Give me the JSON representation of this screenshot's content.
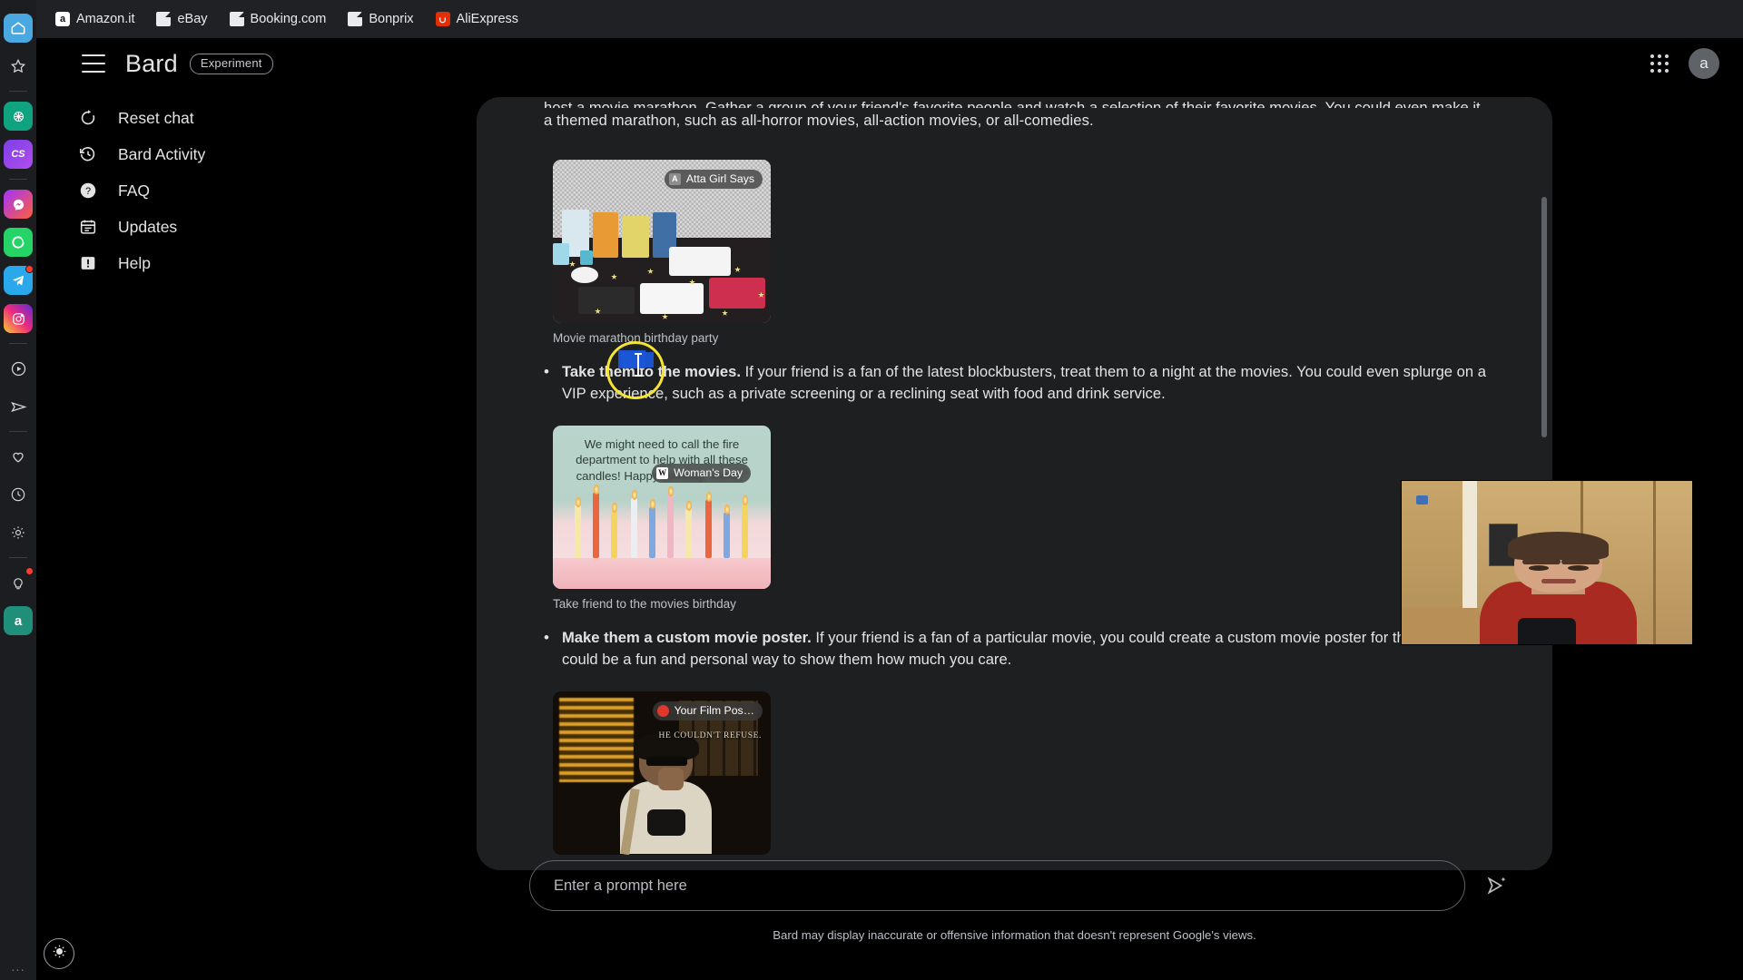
{
  "browser": {
    "bookmarks": [
      {
        "label": "Amazon.it",
        "icon": "amazon-favicon",
        "color": "#ffffff",
        "glyph": "a"
      },
      {
        "label": "eBay",
        "icon": "generic-page-favicon",
        "color": "#e8eaed",
        "glyph": ""
      },
      {
        "label": "Booking.com",
        "icon": "generic-page-favicon",
        "color": "#e8eaed",
        "glyph": ""
      },
      {
        "label": "Bonprix",
        "icon": "generic-page-favicon",
        "color": "#e8eaed",
        "glyph": ""
      },
      {
        "label": "AliExpress",
        "icon": "aliexpress-favicon",
        "color": "#e62e04",
        "glyph": ""
      }
    ]
  },
  "rail": {
    "items": [
      {
        "name": "home-icon",
        "glyph": "home",
        "active": true,
        "badge": false
      },
      {
        "name": "star-icon",
        "glyph": "star",
        "active": false,
        "badge": false
      },
      {
        "name": "separator",
        "glyph": "sep",
        "active": false,
        "badge": false
      },
      {
        "name": "openai-icon",
        "glyph": "openai",
        "active": false,
        "badge": false
      },
      {
        "name": "cs-icon",
        "glyph": "cs",
        "active": false,
        "badge": false
      },
      {
        "name": "separator",
        "glyph": "sep",
        "active": false,
        "badge": false
      },
      {
        "name": "messenger-icon",
        "glyph": "messenger",
        "active": false,
        "badge": false
      },
      {
        "name": "whatsapp-icon",
        "glyph": "whatsapp",
        "active": false,
        "badge": false
      },
      {
        "name": "telegram-icon",
        "glyph": "telegram",
        "active": false,
        "badge": true
      },
      {
        "name": "instagram-icon",
        "glyph": "instagram",
        "active": false,
        "badge": false
      },
      {
        "name": "separator",
        "glyph": "sep",
        "active": false,
        "badge": false
      },
      {
        "name": "play-circle-icon",
        "glyph": "play",
        "active": false,
        "badge": false
      },
      {
        "name": "send-icon",
        "glyph": "send",
        "active": false,
        "badge": false
      },
      {
        "name": "separator",
        "glyph": "sep",
        "active": false,
        "badge": false
      },
      {
        "name": "heart-icon",
        "glyph": "heart",
        "active": false,
        "badge": false
      },
      {
        "name": "clock-icon",
        "glyph": "clock",
        "active": false,
        "badge": false
      },
      {
        "name": "gear-icon",
        "glyph": "gear",
        "active": false,
        "badge": false
      },
      {
        "name": "separator",
        "glyph": "sep",
        "active": false,
        "badge": false
      },
      {
        "name": "lightbulb-icon",
        "glyph": "bulb",
        "active": false,
        "badge": true
      },
      {
        "name": "amazon-assistant-icon",
        "glyph": "a",
        "active": false,
        "badge": false
      }
    ],
    "overflow_label": "..."
  },
  "header": {
    "title": "Bard",
    "chip": "Experiment",
    "avatar_initial": "a"
  },
  "nav": {
    "items": [
      {
        "label": "Reset chat",
        "icon": "reset-icon"
      },
      {
        "label": "Bard Activity",
        "icon": "history-icon"
      },
      {
        "label": "FAQ",
        "icon": "question-mark-icon"
      },
      {
        "label": "Updates",
        "icon": "calendar-icon"
      },
      {
        "label": "Help",
        "icon": "help-feedback-icon"
      }
    ]
  },
  "conversation": {
    "clipped_top_line": "host a movie marathon. Gather a group of your friend's favorite people and watch a selection of their favorite movies. You could even make it",
    "intro_line": "a themed marathon, such as all-horror movies, all-action movies, or all-comedies.",
    "blocks": [
      {
        "image_name": "movie-marathon-party-image",
        "badge_label": "Atta Girl Says",
        "badge_icon": "atta-girl-says-favicon",
        "badge_color": "#8d8d8d",
        "badge_glyph": "A",
        "caption": "Movie marathon birthday party"
      },
      {
        "bullet_bold": "Take them to the movies.",
        "bullet_text": " If your friend is a fan of the latest blockbusters, treat them to a night at the movies. You could even splurge on a VIP experience, such as a private screening or a reclining seat with food and drink service."
      },
      {
        "image_name": "birthday-candles-image",
        "badge_label": "Woman's Day",
        "badge_icon": "womans-day-favicon",
        "badge_color": "#ffffff",
        "badge_glyph": "W",
        "caption": "Take friend to the movies birthday",
        "overlay_quote": "We might need to call the fire department to help with all these candles! Happy birthday, friend.”"
      },
      {
        "bullet_bold": "Make them a custom movie poster.",
        "bullet_text": " If your friend is a fan of a particular movie, you could create a custom movie poster for them. This could be a fun and personal way to show them how much you care."
      },
      {
        "image_name": "custom-movie-poster-image",
        "badge_label": "Your Film Pos…",
        "badge_icon": "your-film-poster-favicon",
        "badge_color": "#e0392b",
        "badge_glyph": "",
        "poster_text": "HE COULDN'T REFUSE."
      }
    ]
  },
  "prompt": {
    "placeholder": "Enter a prompt here",
    "send_icon": "send-sparkle-icon",
    "disclaimer": "Bard may display inaccurate or offensive information that doesn't represent Google's views."
  },
  "selection": {
    "highlighted_text": "em t",
    "annotation": "yellow-circle-highlight",
    "annotation_color": "#f5e433",
    "selection_color": "#1a56d6"
  },
  "webcam": {
    "label": "webcam-overlay"
  },
  "theme_toggle": {
    "icon": "brightness-sun-icon"
  }
}
